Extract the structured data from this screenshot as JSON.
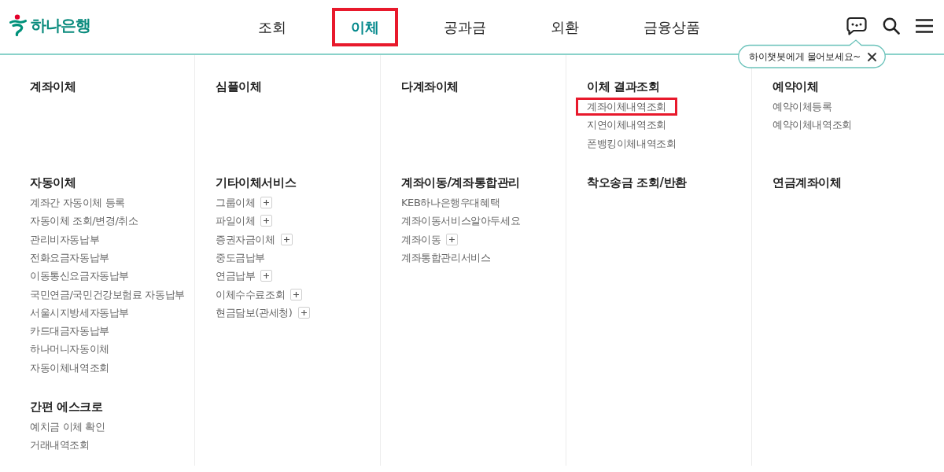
{
  "header": {
    "logo": {
      "text": "하나은행"
    },
    "nav": [
      {
        "label": "조회",
        "selected": false,
        "highlighted": false
      },
      {
        "label": "이체",
        "selected": true,
        "highlighted": true
      },
      {
        "label": "공과금",
        "selected": false,
        "highlighted": false
      },
      {
        "label": "외환",
        "selected": false,
        "highlighted": false
      },
      {
        "label": "금융상품",
        "selected": false,
        "highlighted": false
      }
    ],
    "tooltip": {
      "text": "하이챗봇에게 물어보세요~"
    }
  },
  "menu": {
    "rows": [
      {
        "sections": [
          {
            "title": "계좌이체"
          },
          {
            "title": "심플이체"
          },
          {
            "title": "다계좌이체"
          },
          {
            "title": "이체 결과조회",
            "items": [
              {
                "label": "계좌이체내역조회",
                "highlighted": true
              },
              {
                "label": "지연이체내역조회",
                "highlighted": false
              },
              {
                "label": "폰뱅킹이체내역조회",
                "highlighted": false
              }
            ]
          },
          {
            "title": "예약이체",
            "items": [
              {
                "label": "예약이체등록"
              },
              {
                "label": "예약이체내역조회"
              }
            ]
          }
        ]
      },
      {
        "sections": [
          {
            "title": "자동이체",
            "items": [
              {
                "label": "계좌간 자동이체 등록"
              },
              {
                "label": "자동이체 조회/변경/취소"
              },
              {
                "label": "관리비자동납부"
              },
              {
                "label": "전화요금자동납부"
              },
              {
                "label": "이동통신요금자동납부"
              },
              {
                "label": "국민연금/국민건강보험료 자동납부"
              },
              {
                "label": "서울시지방세자동납부"
              },
              {
                "label": "카드대금자동납부"
              },
              {
                "label": "하나머니자동이체"
              },
              {
                "label": "자동이체내역조회"
              }
            ]
          },
          {
            "title": "기타이체서비스",
            "items": [
              {
                "label": "그룹이체",
                "expandable": true
              },
              {
                "label": "파일이체",
                "expandable": true
              },
              {
                "label": "증권자금이체",
                "expandable": true
              },
              {
                "label": "중도금납부",
                "expandable": false
              },
              {
                "label": "연금납부",
                "expandable": true
              },
              {
                "label": "이체수수료조회",
                "expandable": true
              },
              {
                "label": "현금담보(관세청)",
                "expandable": true
              }
            ]
          },
          {
            "title": "계좌이동/계좌통합관리",
            "items": [
              {
                "label": "KEB하나은행우대혜택",
                "expandable": false
              },
              {
                "label": "계좌이동서비스알아두세요",
                "expandable": false
              },
              {
                "label": "계좌이동",
                "expandable": true
              },
              {
                "label": "계좌통합관리서비스",
                "expandable": false
              }
            ]
          },
          {
            "title": "착오송금 조회/반환"
          },
          {
            "title": "연금계좌이체"
          }
        ]
      },
      {
        "sections": [
          {
            "title": "간편 에스크로",
            "items": [
              {
                "label": "예치금 이체 확인"
              },
              {
                "label": "거래내역조회"
              }
            ]
          }
        ]
      }
    ]
  }
}
